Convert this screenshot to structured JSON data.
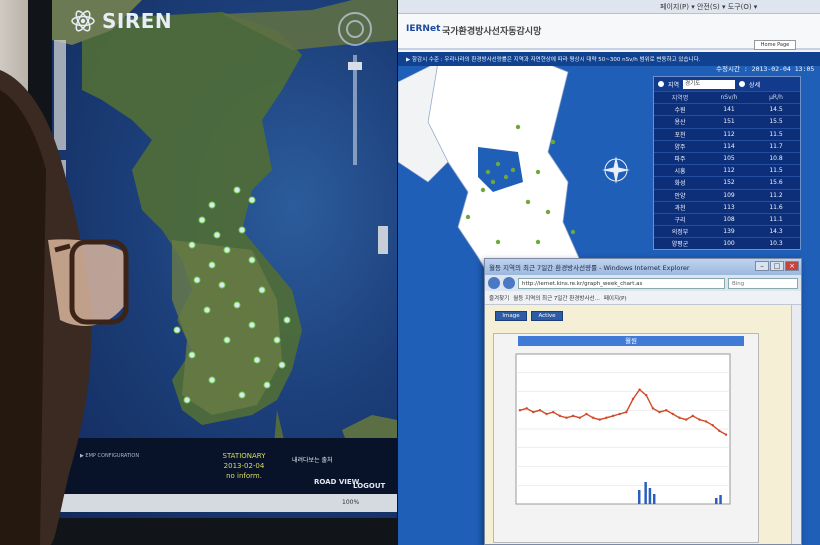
{
  "left_monitor": {
    "app_logo": "SIREN",
    "statistics_status": "STATIONARY",
    "statistics_date": "2013-02-04",
    "statistics_note": "no inform.",
    "road_view_button": "ROAD VIEW",
    "logout_button": "LOGOUT",
    "notice_tag": "▶ EMP CONFIGURATION",
    "map_caption": "내려다보는 출처",
    "zoom": "100%"
  },
  "right_monitor": {
    "site_logo": "IERNet",
    "site_title": "국가환경방사선자동감시망",
    "home_button": "Home Page",
    "info_text": "▶ 항감시 수준 : 우리나라의 환경방사선량률은 지역과 자연현상에 따라 평상시 대략 50~300 nSv/h 범위로 변동하고 있습니다.",
    "time_label": "수정시간 : 2013-02-04 13:05",
    "region_label": "지역",
    "region_value": "경기도",
    "detail_label": "상세",
    "table": {
      "headers": [
        "지역명",
        "nSv/h",
        "μR/h"
      ],
      "rows": [
        [
          "수원",
          "141",
          "14.5"
        ],
        [
          "용산",
          "151",
          "15.5"
        ],
        [
          "포천",
          "112",
          "11.5"
        ],
        [
          "양주",
          "114",
          "11.7"
        ],
        [
          "파주",
          "105",
          "10.8"
        ],
        [
          "시흥",
          "112",
          "11.5"
        ],
        [
          "화성",
          "152",
          "15.6"
        ],
        [
          "안양",
          "109",
          "11.2"
        ],
        [
          "과천",
          "113",
          "11.6"
        ],
        [
          "구리",
          "108",
          "11.1"
        ],
        [
          "의정부",
          "139",
          "14.3"
        ],
        [
          "양평군",
          "100",
          "10.3"
        ]
      ]
    }
  },
  "popup": {
    "window_title": "월등 지역의 최근 7일간 환경방사선량률 - Windows Internet Explorer",
    "url": "http://iernet.kins.re.kr/graph_week_chart.as",
    "search_placeholder": "Bing",
    "favorites": "즐겨찾기",
    "tab_title": "월등 지역의 최근 7일간 환경방사선...",
    "page_menu": "페이지(P)",
    "tab_image": "Image",
    "tab_active": "Active",
    "chart_title": "월원"
  },
  "chart_data": {
    "type": "line",
    "title": "월원",
    "series": [
      {
        "values": [
          110,
          111,
          109,
          110,
          108,
          109,
          107,
          106,
          107,
          106,
          108,
          106,
          105,
          106,
          107,
          108,
          109,
          116,
          121,
          118,
          111,
          109,
          110,
          108,
          106,
          105,
          107,
          105,
          104,
          102,
          99,
          97
        ]
      }
    ]
  },
  "colors": {
    "map_blue": "#1f5fb8",
    "table_blue": "#0d2f7a",
    "line_red": "#d14a2a",
    "bar_blue": "#2a5fbf",
    "chart_header": "#3f7bd6"
  }
}
